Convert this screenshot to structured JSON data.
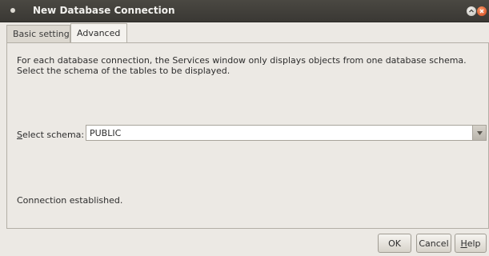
{
  "window": {
    "title": "New Database Connection"
  },
  "tabs": [
    {
      "label": "Basic setting",
      "active": false
    },
    {
      "label": "Advanced",
      "active": true
    }
  ],
  "advanced": {
    "description_line1": "For each database connection, the Services window only displays objects from one database schema.",
    "description_line2": "Select the schema of the tables to be displayed.",
    "schema_label_mnemonic": "S",
    "schema_label_rest": "elect schema:",
    "schema_value": "PUBLIC",
    "status": "Connection established."
  },
  "buttons": {
    "ok": "OK",
    "cancel": "Cancel",
    "help_mnemonic": "H",
    "help_rest": "elp"
  },
  "icons": {
    "window_menu": "window-menu-icon",
    "minimize": "minimize-icon",
    "close": "close-icon",
    "dropdown": "chevron-down-icon"
  },
  "colors": {
    "titlebar": "#3a3834",
    "close_button": "#d4451b",
    "dialog_background": "#ece9e4"
  }
}
